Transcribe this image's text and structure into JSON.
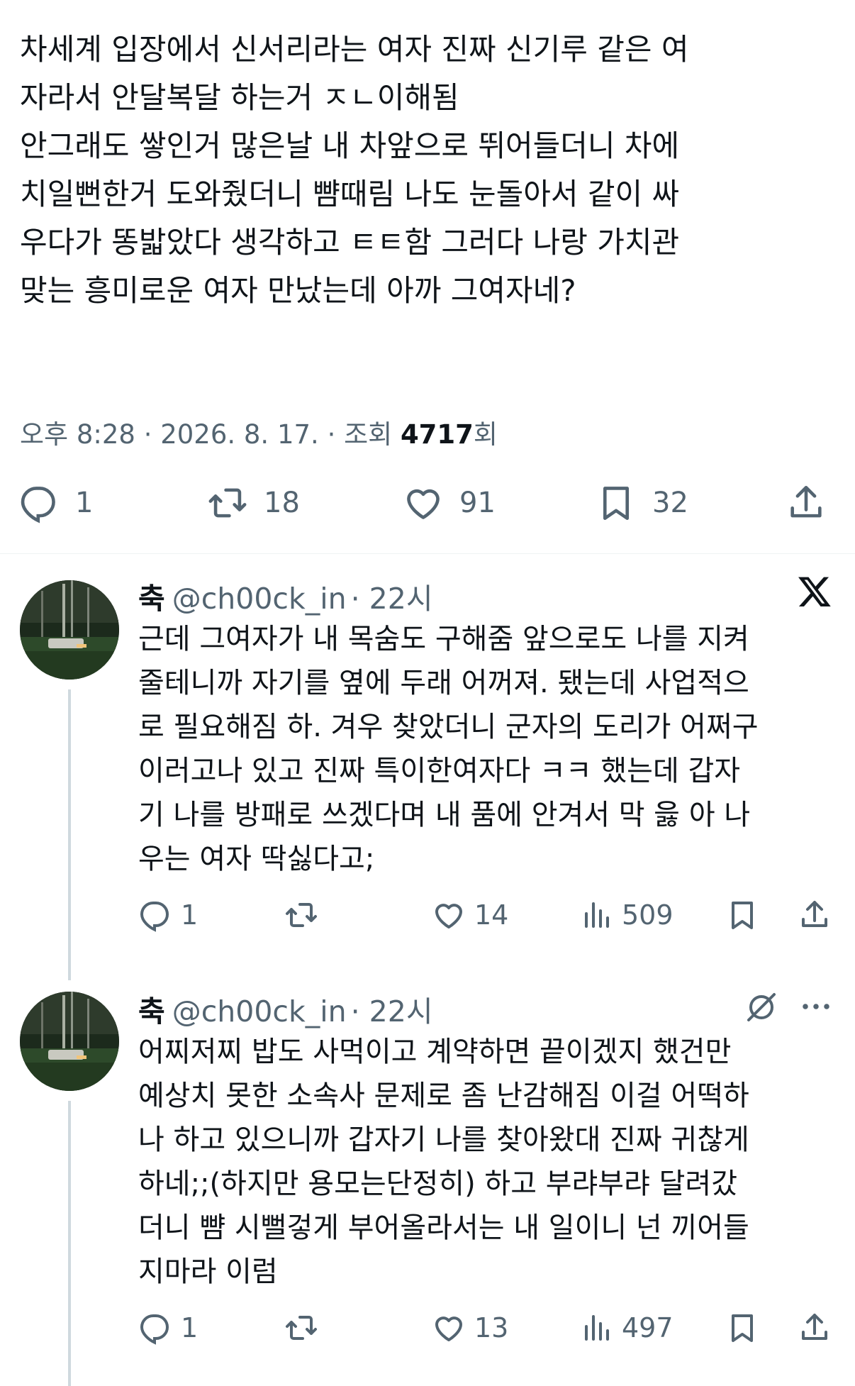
{
  "main_post": {
    "lines": [
      "차세계 입장에서 신서리라는 여자 진짜 신기루 같은 여",
      "자라서 안달복달 하는거 ㅈㄴ이해됨",
      "안그래도 쌓인거 많은날 내 차앞으로 뛰어들더니 차에",
      "치일뻔한거 도와줬더니 뺨때림 나도 눈돌아서 같이 싸",
      "우다가 똥밟았다 생각하고 ㅌㅌ함 그러다 나랑 가치관",
      "맞는 흥미로운 여자 만났는데 아까 그여자네?"
    ],
    "meta_prefix": "오후 8:28 · 2026. 8. 17. · 조회 ",
    "views": "4717",
    "views_suffix": "회",
    "replies": "1",
    "reposts": "18",
    "likes": "91",
    "bookmarks": "32"
  },
  "replies": [
    {
      "name": "축",
      "handle": "@ch00ck_in",
      "time": "· 22시",
      "lines": [
        "근데 그여자가 내 목숨도 구해줌 앞으로도 나를 지켜",
        "줄테니까 자기를 옆에 두래 어꺼져. 됐는데 사업적으",
        "로 필요해짐 하. 겨우 찾았더니 군자의 도리가 어쩌구",
        "이러고나 있고 진짜 특이한여자다 ㅋㅋ 했는데 갑자",
        "기 나를 방패로 쓰겠다며 내 품에 안겨서 막 읋 아 나",
        "우는 여자 딱싫다고;"
      ],
      "replies": "1",
      "reposts": "",
      "likes": "14",
      "views": "509"
    },
    {
      "name": "축",
      "handle": "@ch00ck_in",
      "time": "· 22시",
      "lines": [
        "어찌저찌 밥도 사먹이고 계약하면 끝이겠지 했건만",
        "예상치 못한 소속사 문제로 좀 난감해짐 이걸 어떡하",
        "나 하고 있으니까 갑자기 나를 찾아왔대 진짜 귀찮게",
        "하네;;(하지만 용모는단정히) 하고 부랴부랴 달려갔",
        "더니 뺨 시뻘겋게 부어올라서는 내 일이니 넌 끼어들",
        "지마라 이럼"
      ],
      "replies": "1",
      "reposts": "",
      "likes": "13",
      "views": "497"
    }
  ],
  "colors": {
    "text": "#0f1419",
    "secondary": "#536471",
    "thread": "#cfd9de"
  },
  "icons": [
    "reply-icon",
    "repost-icon",
    "like-icon",
    "bookmark-icon",
    "share-icon",
    "views-icon",
    "x-logo-icon",
    "grok-icon",
    "more-icon"
  ]
}
